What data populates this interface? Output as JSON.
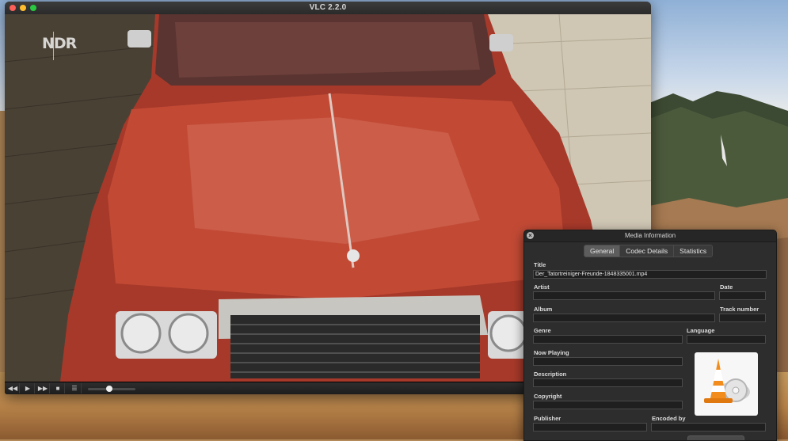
{
  "vlc": {
    "title": "VLC 2.2.0",
    "channel_logo": "NDR",
    "controls": {
      "rewind_icon": "rewind-icon",
      "play_icon": "play-icon",
      "forward_icon": "fast-forward-icon",
      "stop_icon": "stop-icon",
      "playlist_icon": "playlist-icon",
      "seek_progress": 0.45
    }
  },
  "media_info": {
    "window_title": "Media Information",
    "tabs": [
      {
        "label": "General",
        "active": true
      },
      {
        "label": "Codec Details",
        "active": false
      },
      {
        "label": "Statistics",
        "active": false
      }
    ],
    "fields": {
      "title_label": "Title",
      "title_value": "Der_Tatortreiniger-Freunde-1848335001.mp4",
      "artist_label": "Artist",
      "artist_value": "",
      "date_label": "Date",
      "date_value": "",
      "album_label": "Album",
      "album_value": "",
      "track_number_label": "Track number",
      "track_number_value": "",
      "genre_label": "Genre",
      "genre_value": "",
      "language_label": "Language",
      "language_value": "",
      "now_playing_label": "Now Playing",
      "now_playing_value": "",
      "description_label": "Description",
      "description_value": "",
      "copyright_label": "Copyright",
      "copyright_value": "",
      "publisher_label": "Publisher",
      "publisher_value": "",
      "encoded_by_label": "Encoded by",
      "encoded_by_value": ""
    },
    "artwork_icon": "vlc-cone-icon"
  },
  "colors": {
    "car_red": "#b8432f",
    "window_chrome": "#2d2d2d",
    "close_red": "#fc5f57",
    "minimize_yellow": "#fdbc2e",
    "zoom_green": "#29c840"
  }
}
